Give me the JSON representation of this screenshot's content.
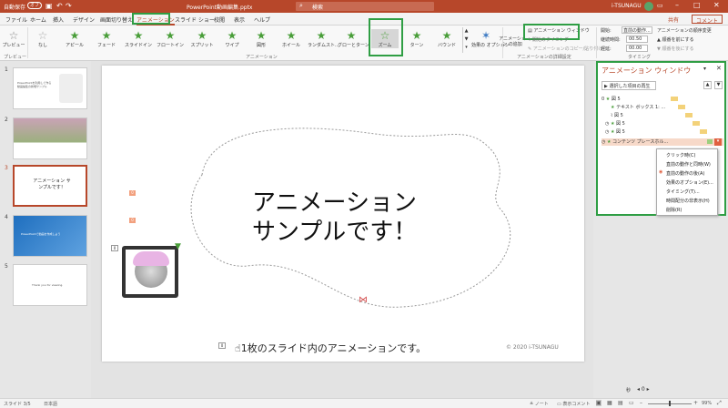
{
  "titlebar": {
    "autosave": "自動保存",
    "autosave_state": "オフ",
    "filename": "PowerPoint動画編集.pptx",
    "search": "検索",
    "user": "i-TSUNAGU"
  },
  "tabs": [
    "ファイル",
    "ホーム",
    "挿入",
    "デザイン",
    "画面切り替え",
    "アニメーション",
    "スライド ショー",
    "校閲",
    "表示",
    "ヘルプ"
  ],
  "share": "共有",
  "comment": "コメント",
  "ribbon": {
    "preview": "プレビュー",
    "effects": [
      "なし",
      "アピール",
      "フェード",
      "スライドイン",
      "フロートイン",
      "スプリット",
      "ワイプ",
      "図形",
      "ホイール",
      "ランダムスト...",
      "グローとターン",
      "ズーム",
      "ターン",
      "バウンド"
    ],
    "effect_options": "効果の オプション",
    "add_anim": "アニメーション の追加",
    "anim_pane": "アニメーション ウィンドウ",
    "trigger": "開始のタイミング",
    "copy_anim": "アニメーションのコピー/貼り付け",
    "start_label": "開始:",
    "start_value": "直前の動作...",
    "duration_label": "継続時間:",
    "duration_value": "00.50",
    "delay_label": "遅延:",
    "delay_value": "00.00",
    "reorder": "アニメーションの順序変更",
    "earlier": "順番を前にする",
    "later": "順番を後にする",
    "groups": [
      "プレビュー",
      "アニメーション",
      "アニメーションの詳細設定",
      "タイミング"
    ]
  },
  "thumbs": [
    {
      "num": "1"
    },
    {
      "num": "2"
    },
    {
      "num": "3"
    },
    {
      "num": "4"
    },
    {
      "num": "5"
    }
  ],
  "thumb_text": {
    "t1": "PowerPointを利用して作る動画編集の新規サンプル",
    "t3": "アニメーション サンプルです！",
    "t4": "PowerPointで動画を作成しよう",
    "t5": "Thank you for viewing."
  },
  "slide": {
    "title_line1": "アニメーション",
    "title_line2": "サンプルです！",
    "caption": "1枚のスライド内のアニメーションです。",
    "copyright": "© 2020 i-TSUNAGU",
    "tag0": "0",
    "tag_a": "0",
    "tag_b": "0",
    "tag_c": "0"
  },
  "animpane": {
    "title": "アニメーション ウィンドウ",
    "play": "選択した項目の再生",
    "rows": [
      {
        "n": "0",
        "label": "図 5"
      },
      {
        "n": "",
        "label": "テキスト ボックス 1: ..."
      },
      {
        "n": "",
        "label": "図 5"
      },
      {
        "n": "",
        "label": "図 5"
      },
      {
        "n": "",
        "label": "図 5"
      },
      {
        "n": "",
        "label": "コンテンツ プレースホル..."
      }
    ],
    "ctx": [
      "クリック時(C)",
      "直前の動作と同時(W)",
      "直前の動作の後(A)",
      "効果のオプション(E)...",
      "タイミング(T)...",
      "時間配分の非表示(H)",
      "削除(R)"
    ],
    "seconds": "秒"
  },
  "status": {
    "slide": "スライド 3/5",
    "lang": "日本語",
    "notes": "ノート",
    "comments": "表示コメント",
    "zoom": "99%"
  }
}
